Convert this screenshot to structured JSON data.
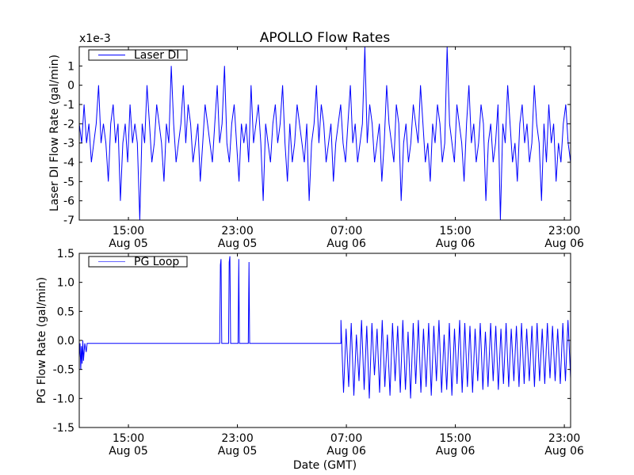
{
  "chart_data": [
    {
      "type": "line",
      "title": "APOLLO Flow Rates",
      "ylabel": "Laser DI Flow Rate (gal/min)",
      "xlabel": "",
      "offset_label": "x1e-3",
      "ylim": [
        -7,
        2
      ],
      "xlim_hours_from_aug05": [
        11.39,
        47.46
      ],
      "yticks": [
        1,
        0,
        -1,
        -2,
        -3,
        -4,
        -5,
        -6,
        -7
      ],
      "ytick_labels": [
        "1",
        "0",
        "-1",
        "-2",
        "-3",
        "-4",
        "-5",
        "-6",
        "-7"
      ],
      "xticks_hours": [
        15,
        23,
        31,
        39,
        47
      ],
      "xtick_labels": [
        [
          "15:00",
          "Aug 05"
        ],
        [
          "23:00",
          "Aug 05"
        ],
        [
          "07:00",
          "Aug 06"
        ],
        [
          "15:00",
          "Aug 06"
        ],
        [
          "23:00",
          "Aug 06"
        ]
      ],
      "legend": {
        "label": "Laser DI",
        "placement": "top-left"
      },
      "series": [
        {
          "name": "Laser DI",
          "color": "#0000ff",
          "x_range_hours": [
            11.39,
            47.46
          ],
          "values": [
            -2,
            -3,
            -1,
            -3,
            -2,
            -4,
            -3,
            -2,
            0,
            -3,
            -2,
            -3,
            -5,
            -2,
            -1,
            -3,
            -2,
            -6,
            -3,
            -2,
            -4,
            -1,
            -3,
            -2,
            -3,
            -7,
            -2,
            -3,
            0,
            -2,
            -4,
            -3,
            -1,
            -2,
            -3,
            -5,
            -2,
            -3,
            1,
            -2,
            -4,
            -3,
            -2,
            0,
            -3,
            -1,
            -2,
            -4,
            -3,
            -2,
            -5,
            -3,
            -1,
            -2,
            -3,
            -4,
            -2,
            0,
            -3,
            -2,
            1,
            -3,
            -4,
            -2,
            -1,
            -3,
            -5,
            -2,
            -3,
            -2,
            -4,
            0,
            -3,
            -2,
            -1,
            -3,
            -6,
            -2,
            -3,
            -4,
            -2,
            -1,
            -3,
            -2,
            0,
            -3,
            -5,
            -2,
            -4,
            -3,
            -1,
            -2,
            -3,
            -4,
            -2,
            -6,
            -3,
            -2,
            0,
            -3,
            -1,
            -2,
            -4,
            -3,
            -2,
            -5,
            -3,
            -2,
            -1,
            -3,
            -4,
            -2,
            0,
            -3,
            -2,
            -4,
            -3,
            -2,
            2,
            -3,
            -1,
            -2,
            -4,
            -3,
            -2,
            -5,
            -3,
            0,
            -2,
            -3,
            -4,
            -1,
            -2,
            -6,
            -3,
            -2,
            -4,
            -3,
            -1,
            -2,
            -3,
            0,
            -2,
            -4,
            -3,
            -5,
            -2,
            -3,
            -1,
            -2,
            -4,
            -3,
            2,
            -2,
            -3,
            -4,
            -1,
            -2,
            -3,
            -5,
            -2,
            0,
            -3,
            -2,
            -4,
            -3,
            -1,
            -2,
            -6,
            -3,
            -2,
            -4,
            -3,
            -1,
            -7,
            -2,
            -3,
            0,
            -2,
            -4,
            -3,
            -5,
            -2,
            -1,
            -3,
            -2,
            -4,
            -3,
            0,
            -2,
            -3,
            -6,
            -2,
            -4,
            -1,
            -3,
            -2,
            -5,
            -3,
            -4,
            -2,
            -1,
            -3,
            -4
          ]
        }
      ]
    },
    {
      "type": "line",
      "title": "",
      "ylabel": "PG Flow Rate (gal/min)",
      "xlabel": "Date (GMT)",
      "ylim": [
        -1.5,
        1.5
      ],
      "xlim_hours_from_aug05": [
        11.39,
        47.46
      ],
      "yticks": [
        1.5,
        1.0,
        0.5,
        0.0,
        -0.5,
        -1.0,
        -1.5
      ],
      "ytick_labels": [
        "1.5",
        "1.0",
        "0.5",
        "0.0",
        "-0.5",
        "-1.0",
        "-1.5"
      ],
      "xticks_hours": [
        15,
        23,
        31,
        39,
        47
      ],
      "xtick_labels": [
        [
          "15:00",
          "Aug 05"
        ],
        [
          "23:00",
          "Aug 05"
        ],
        [
          "07:00",
          "Aug 06"
        ],
        [
          "15:00",
          "Aug 06"
        ],
        [
          "23:00",
          "Aug 06"
        ]
      ],
      "legend": {
        "label": "PG Loop",
        "placement": "top-left"
      },
      "series": [
        {
          "name": "PG Loop",
          "color": "#0000ff",
          "points": [
            [
              11.39,
              -0.3
            ],
            [
              11.45,
              -0.05
            ],
            [
              11.5,
              -0.5
            ],
            [
              11.55,
              -0.1
            ],
            [
              11.6,
              -0.4
            ],
            [
              11.65,
              0
            ],
            [
              11.7,
              -0.35
            ],
            [
              11.8,
              -0.05
            ],
            [
              11.9,
              -0.2
            ],
            [
              11.97,
              -0.05
            ],
            [
              21.7,
              -0.05
            ],
            [
              21.75,
              1.3
            ],
            [
              21.8,
              1.4
            ],
            [
              21.85,
              -0.05
            ],
            [
              22.35,
              -0.05
            ],
            [
              22.4,
              1.35
            ],
            [
              22.45,
              1.45
            ],
            [
              22.5,
              -0.05
            ],
            [
              23.05,
              -0.05
            ],
            [
              23.1,
              1.4
            ],
            [
              23.15,
              -0.05
            ],
            [
              23.8,
              -0.05
            ],
            [
              23.85,
              1.35
            ],
            [
              23.9,
              -0.05
            ],
            [
              30.6,
              -0.05
            ]
          ],
          "noise_x_range_hours": [
            30.6,
            47.46
          ],
          "noise_values": [
            0.35,
            -0.9,
            0.2,
            -0.8,
            0.3,
            -0.95,
            0.1,
            -0.7,
            0.35,
            -0.85,
            0.25,
            -1.0,
            0.3,
            -0.6,
            0.2,
            -0.9,
            0.35,
            -0.8,
            0.1,
            -0.95,
            0.3,
            -0.7,
            0.25,
            -0.9,
            0.35,
            -0.85,
            0.15,
            -1.0,
            0.3,
            -0.75,
            0.35,
            -0.9,
            0.2,
            -0.8,
            0.3,
            -0.95,
            0.25,
            -0.7,
            0.35,
            -0.9,
            0.1,
            -0.85,
            0.3,
            -0.95,
            0.2,
            -0.75,
            0.35,
            -0.9,
            0.3,
            -0.8,
            0.25,
            -0.9,
            0.2,
            -0.7,
            0.3,
            -0.85,
            0.15,
            -0.8,
            0.3,
            -0.7,
            0.25,
            -0.85,
            0.2,
            -0.75,
            0.3,
            -0.8,
            0.2,
            -0.7,
            0.25,
            -0.8,
            0.3,
            -0.75,
            0.2,
            -0.7,
            0.25,
            -0.8,
            0.3,
            -0.7,
            0.2,
            -0.75,
            0.3,
            -0.65,
            0.25,
            -0.7,
            0.2,
            -0.75,
            0.3,
            -0.7,
            0.35,
            -0.65
          ]
        }
      ]
    }
  ]
}
